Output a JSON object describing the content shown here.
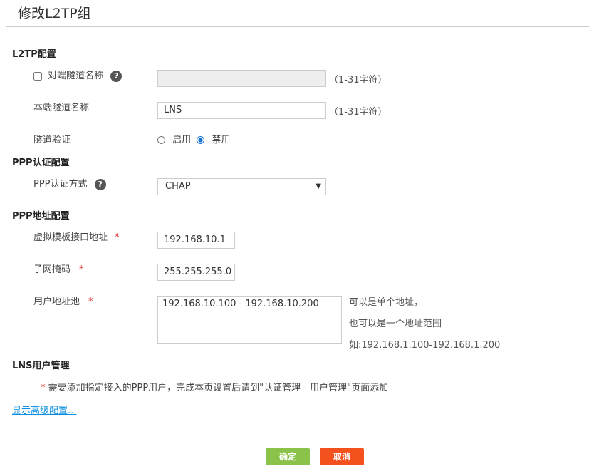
{
  "title": "修改L2TP组",
  "l2tp": {
    "header": "L2TP配置",
    "peer_label": "对端隧道名称",
    "peer_value": "",
    "peer_checked": false,
    "peer_hint": "（1-31字符）",
    "local_label": "本端隧道名称",
    "local_value": "LNS",
    "local_hint": "（1-31字符）",
    "auth_label": "隧道验证",
    "enable": "启用",
    "disable": "禁用",
    "selected": "禁用"
  },
  "ppp_auth": {
    "header": "PPP认证配置",
    "method_label": "PPP认证方式",
    "method_value": "CHAP"
  },
  "ppp_addr": {
    "header": "PPP地址配置",
    "vt_label": "虚拟模板接口地址",
    "vt_value": "192.168.10.1",
    "mask_label": "子网掩码",
    "mask_value": "255.255.255.0",
    "pool_label": "用户地址池",
    "pool_value": "192.168.10.100 - 192.168.10.200",
    "hint1": "可以是单个地址，",
    "hint2": "也可以是一个地址范围",
    "hint3": "如:192.168.1.100-192.168.1.200"
  },
  "lns": {
    "header": "LNS用户管理",
    "note": "需要添加指定接入的PPP用户，完成本页设置后请到\"认证管理 - 用户管理\"页面添加"
  },
  "advanced_link": "显示高级配置...",
  "buttons": {
    "ok": "确定",
    "cancel": "取消"
  },
  "colors": {
    "ok": "#8bc34a",
    "cancel": "#f4511e",
    "link": "#0a8fe0",
    "required": "#e53935"
  }
}
